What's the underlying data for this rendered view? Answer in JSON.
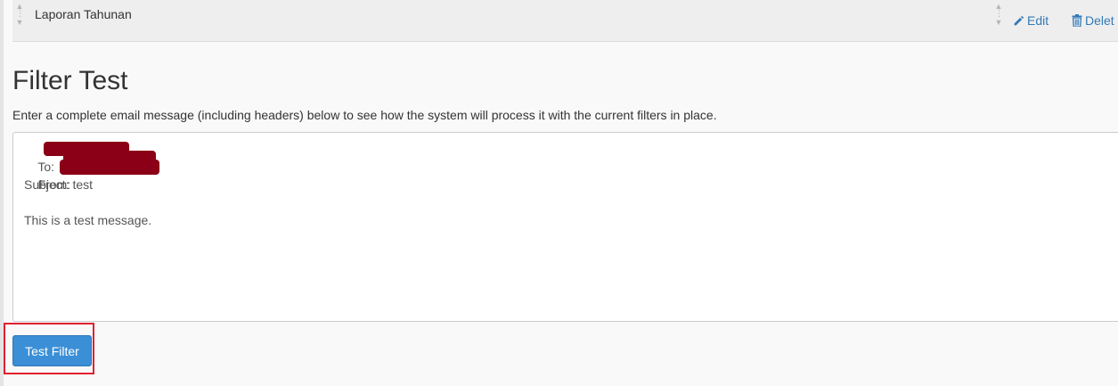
{
  "filter_row": {
    "name": "Laporan Tahunan",
    "edit_label": "Edit",
    "delete_label": "Delet"
  },
  "filter_test": {
    "title": "Filter Test",
    "description": "Enter a complete email message (including headers) below to see how the system will process it with the current filters in place.",
    "message_lines": {
      "to": "To:",
      "from": "From:",
      "subject": "Subject: test",
      "blank": "",
      "body": "This is a test message."
    },
    "button_label": "Test Filter"
  },
  "colors": {
    "link": "#337ab7",
    "button": "#3a8fd6",
    "redaction": "#8b0016",
    "highlight": "#e0202f"
  },
  "icons": {
    "edit": "pencil-icon",
    "delete": "trash-icon",
    "reorder": "drag-handle-icon"
  }
}
